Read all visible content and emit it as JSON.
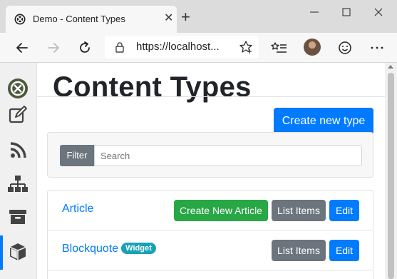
{
  "browser": {
    "tab_title": "Demo - Content Types",
    "tab_close": "✕",
    "new_tab": "+",
    "url": "https://localhost..."
  },
  "page": {
    "title": "Content Types",
    "create_button": "Create new type",
    "filter_label": "Filter",
    "search_placeholder": "Search"
  },
  "content_types": [
    {
      "name": "Article",
      "badge": "",
      "actions": {
        "create": "Create New Article",
        "list": "List Items",
        "edit": "Edit"
      }
    },
    {
      "name": "Blockquote",
      "badge": "Widget",
      "actions": {
        "list": "List Items",
        "edit": "Edit"
      }
    }
  ],
  "sidebar": {
    "items": [
      "orchard-logo-icon",
      "edit-icon",
      "rss-icon",
      "sitemap-icon",
      "archive-icon",
      "cube-icon"
    ],
    "active": "cube-icon"
  },
  "colors": {
    "primary": "#007bff",
    "success": "#28a745",
    "secondary": "#6c757d",
    "info": "#17a2b8"
  }
}
